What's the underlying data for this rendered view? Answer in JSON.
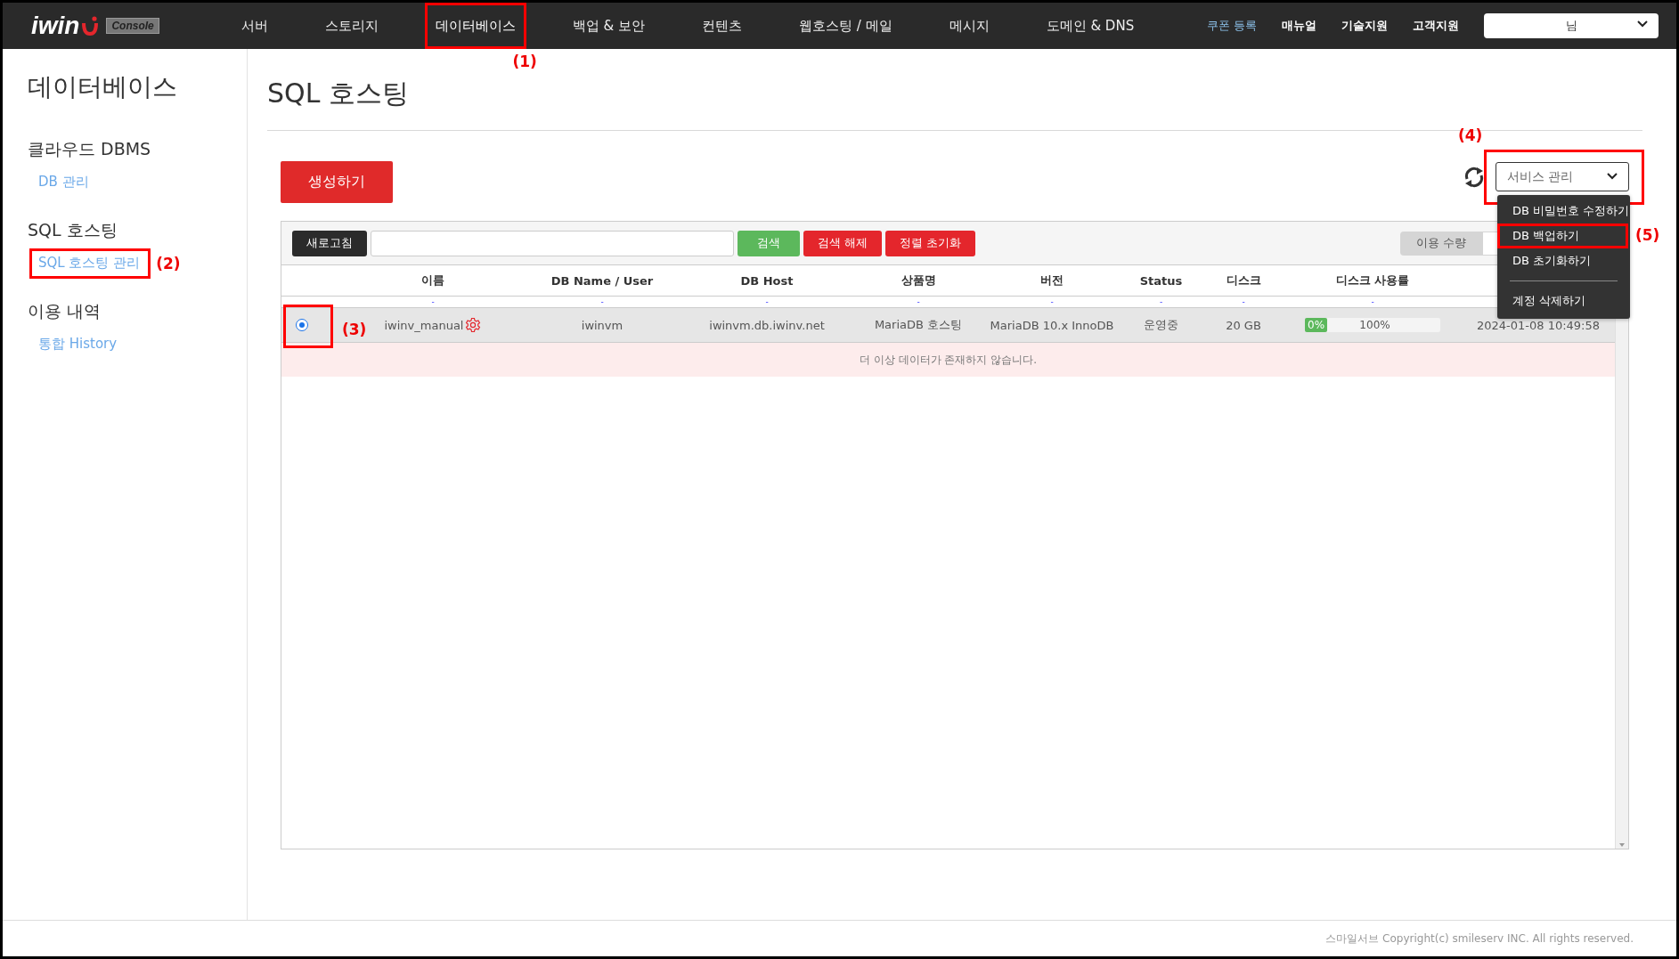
{
  "header": {
    "logo": {
      "text": "iwin",
      "badge": "Console"
    },
    "nav": [
      {
        "label": "서버",
        "selected": false
      },
      {
        "label": "스토리지",
        "selected": false
      },
      {
        "label": "데이터베이스",
        "selected": true,
        "annotation": "(1)"
      },
      {
        "label": "백업 & 보안",
        "selected": false
      },
      {
        "label": "컨텐츠",
        "selected": false
      },
      {
        "label": "웹호스팅 / 메일",
        "selected": false
      },
      {
        "label": "메시지",
        "selected": false
      },
      {
        "label": "도메인 & DNS",
        "selected": false
      }
    ],
    "links": [
      {
        "label": "쿠폰 등록",
        "kind": "highlight"
      },
      {
        "label": "매뉴얼",
        "kind": "plain"
      },
      {
        "label": "기술지원",
        "kind": "plain"
      },
      {
        "label": "고객지원",
        "kind": "plain"
      }
    ],
    "account": {
      "value": "님"
    }
  },
  "sidebar": {
    "title": "데이터베이스",
    "sections": [
      {
        "heading": "클라우드 DBMS",
        "items": [
          {
            "label": "DB 관리"
          }
        ]
      },
      {
        "heading": "SQL 호스팅",
        "items": [
          {
            "label": "SQL 호스팅 관리",
            "annotation": "(2)"
          }
        ]
      },
      {
        "heading": "이용 내역",
        "items": [
          {
            "label": "통합 History"
          }
        ]
      }
    ]
  },
  "main": {
    "title": "SQL 호스팅",
    "create_button": "생성하기",
    "service_select": {
      "value": "서비스 관리",
      "expanded": true,
      "annotation": "(4)",
      "options": [
        {
          "label": "DB 비밀번호 수정하기"
        },
        {
          "label": "DB 백업하기",
          "annotation": "(5)"
        },
        {
          "label": "DB 초기화하기"
        },
        {
          "label": "계정 삭제하기",
          "divider_before": true
        }
      ]
    },
    "toolbar": {
      "refresh": "새로고침",
      "search": "검색",
      "clear": "검색 해제",
      "reset_sort": "정렬 초기화",
      "usage_toggle": "이용 수량"
    },
    "table": {
      "columns": [
        {
          "label": "이름",
          "filter": "-"
        },
        {
          "label": "DB Name / User",
          "filter": "-"
        },
        {
          "label": "DB Host",
          "filter": "-"
        },
        {
          "label": "상품명",
          "filter": "-"
        },
        {
          "label": "버전",
          "filter": "-"
        },
        {
          "label": "Status",
          "filter": "-"
        },
        {
          "label": "디스크",
          "filter": "-"
        },
        {
          "label": "디스크 사용률",
          "filter": "-"
        }
      ],
      "rows": [
        {
          "selected": true,
          "annotation": "(3)",
          "name": "iwinv_manual",
          "db_name": "iwinvm",
          "db_host": "iwinvm.db.iwinv.net",
          "product": "MariaDB 호스팅",
          "version": "MariaDB 10.x InnoDB",
          "status": "운영중",
          "disk": "20 GB",
          "usage": {
            "level": 0,
            "label": "0%",
            "rest": "100%"
          },
          "created": "2024-01-08 10:49:58"
        }
      ],
      "empty_message": "더 이상 데이터가 존재하지 않습니다."
    }
  },
  "footer": "스마일서브 Copyright(c) smileserv INC. All rights reserved."
}
